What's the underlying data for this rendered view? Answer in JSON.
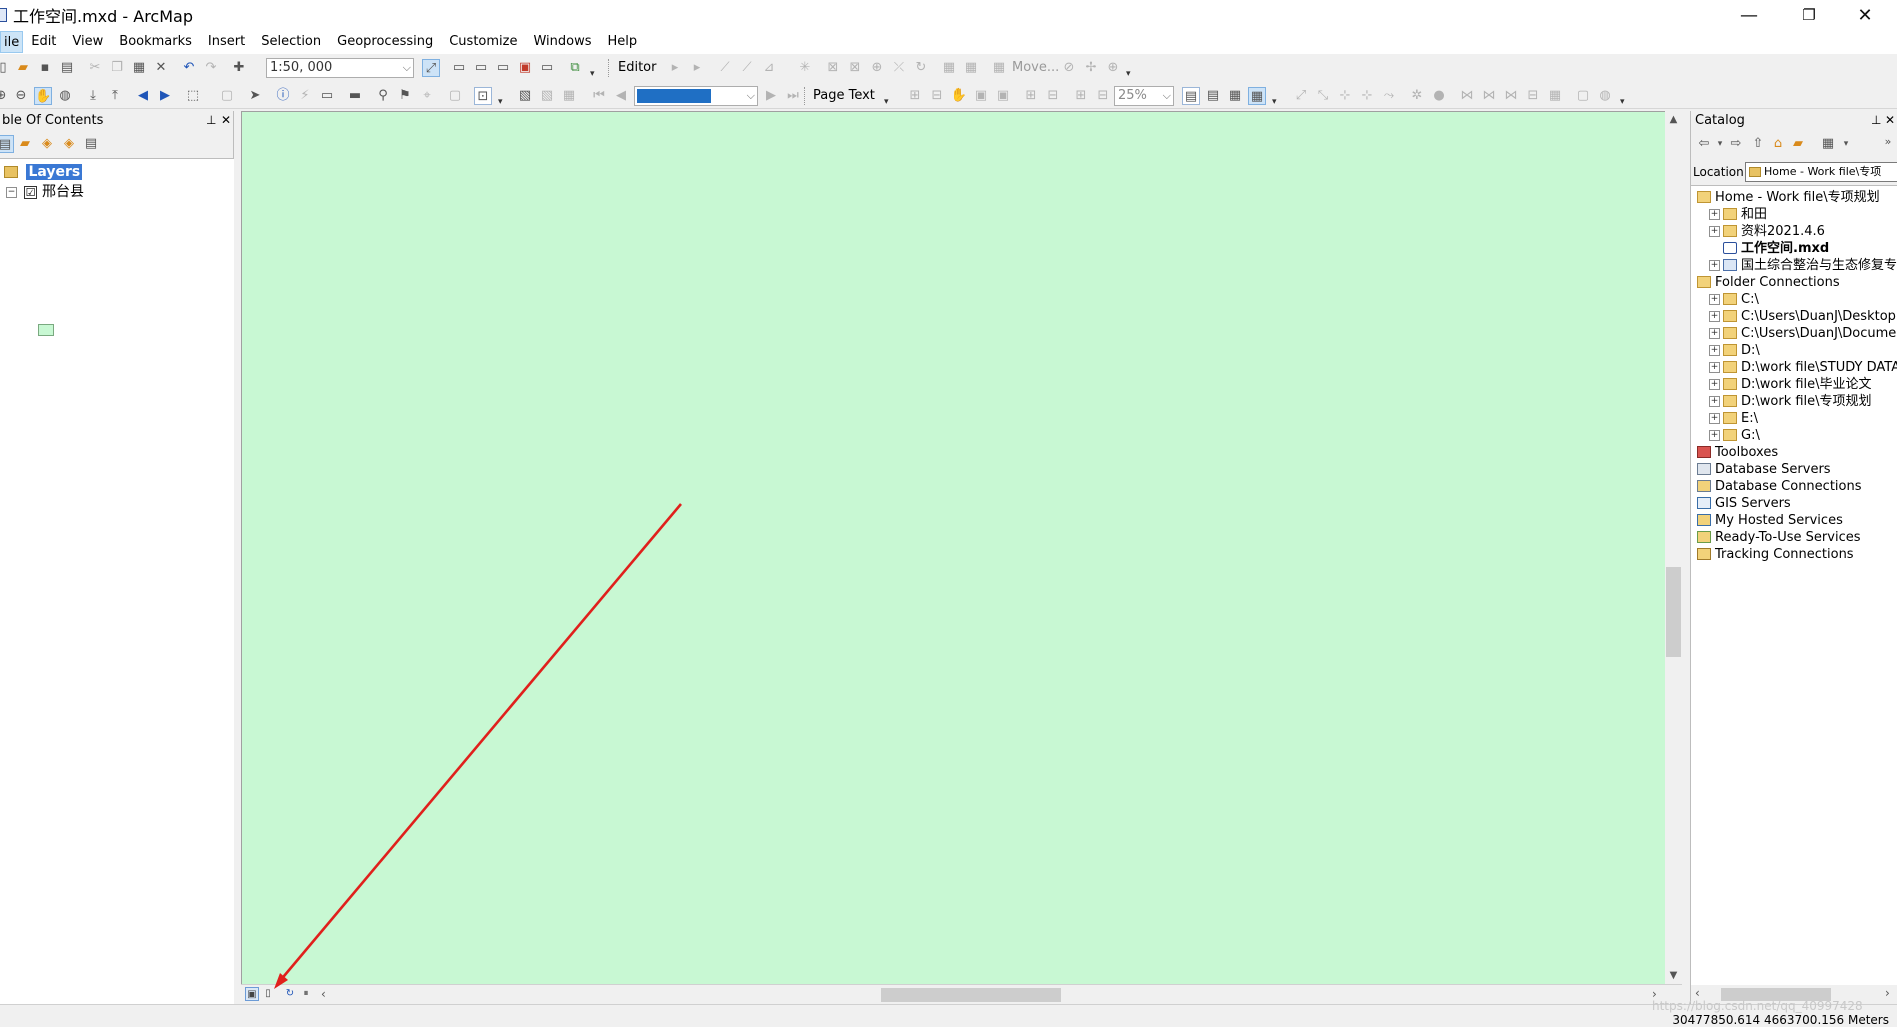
{
  "window": {
    "title": "工作空间.mxd - ArcMap",
    "minimize": "—",
    "restore": "❐",
    "close": "✕"
  },
  "menu": [
    "ile",
    "Edit",
    "View",
    "Bookmarks",
    "Insert",
    "Selection",
    "Geoprocessing",
    "Customize",
    "Windows",
    "Help"
  ],
  "toolbar": {
    "scale": "1:50, 000",
    "editor": "Editor",
    "move": "Move...",
    "page_text": "Page Text",
    "zoom_percent": "25%"
  },
  "toc": {
    "title": "ble Of Contents",
    "pin": "𝟦",
    "close": "✕",
    "layers_label": "Layers",
    "layer_name": "邢台县",
    "layer_checked": "☑"
  },
  "catalog": {
    "title": "Catalog",
    "location_label": "Location:",
    "location_value": "Home - Work file\\专项",
    "items": [
      {
        "label": "Home - Work file\\专项规划",
        "icon": "home-folder-icon",
        "expander": "",
        "indent": 0
      },
      {
        "label": "和田",
        "icon": "folder-icon",
        "expander": "+",
        "indent": 1
      },
      {
        "label": "资料2021.4.6",
        "icon": "folder-icon",
        "expander": "+",
        "indent": 1
      },
      {
        "label": "工作空间.mxd",
        "icon": "mxd-icon",
        "expander": "",
        "indent": 1,
        "bold": true
      },
      {
        "label": "国土综合整治与生态修复专项",
        "icon": "gdb-icon",
        "expander": "+",
        "indent": 1
      },
      {
        "label": "Folder Connections",
        "icon": "folder-connections-icon",
        "expander": "",
        "indent": 0
      },
      {
        "label": "C:\\",
        "icon": "folder-icon",
        "expander": "+",
        "indent": 1
      },
      {
        "label": "C:\\Users\\DuanJ\\Desktop",
        "icon": "folder-icon",
        "expander": "+",
        "indent": 1
      },
      {
        "label": "C:\\Users\\DuanJ\\Documents",
        "icon": "folder-icon",
        "expander": "+",
        "indent": 1
      },
      {
        "label": "D:\\",
        "icon": "folder-icon",
        "expander": "+",
        "indent": 1
      },
      {
        "label": "D:\\work file\\STUDY DATA",
        "icon": "folder-icon",
        "expander": "+",
        "indent": 1
      },
      {
        "label": "D:\\work file\\毕业论文",
        "icon": "folder-icon",
        "expander": "+",
        "indent": 1
      },
      {
        "label": "D:\\work file\\专项规划",
        "icon": "folder-icon",
        "expander": "+",
        "indent": 1
      },
      {
        "label": "E:\\",
        "icon": "folder-icon",
        "expander": "+",
        "indent": 1
      },
      {
        "label": "G:\\",
        "icon": "folder-icon",
        "expander": "+",
        "indent": 1
      },
      {
        "label": "Toolboxes",
        "icon": "toolbox-icon",
        "expander": "",
        "indent": 0
      },
      {
        "label": "Database Servers",
        "icon": "database-server-icon",
        "expander": "",
        "indent": 0
      },
      {
        "label": "Database Connections",
        "icon": "database-connection-icon",
        "expander": "",
        "indent": 0
      },
      {
        "label": "GIS Servers",
        "icon": "gis-server-icon",
        "expander": "",
        "indent": 0
      },
      {
        "label": "My Hosted Services",
        "icon": "hosted-services-icon",
        "expander": "",
        "indent": 0
      },
      {
        "label": "Ready-To-Use Services",
        "icon": "ready-services-icon",
        "expander": "",
        "indent": 0
      },
      {
        "label": "Tracking Connections",
        "icon": "tracking-connections-icon",
        "expander": "",
        "indent": 0
      }
    ]
  },
  "status": {
    "coordinates": "30477850.614  4663700.156 Meters",
    "watermark": "https://blog.csdn.net/qq_40997428"
  },
  "colors": {
    "map_background": "#c8f8d3",
    "annotation_arrow": "#e0201c",
    "layers_highlight": "#3a78d4"
  }
}
